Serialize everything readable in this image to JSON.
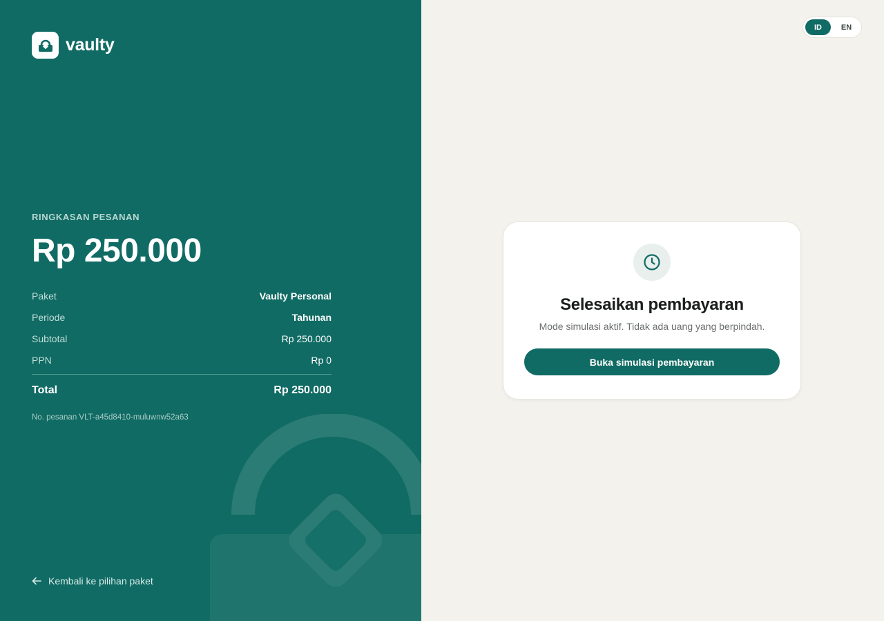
{
  "brand": {
    "name": "vaulty"
  },
  "summary": {
    "label": "RINGKASAN PESANAN",
    "amount": "Rp 250.000",
    "rows": [
      {
        "key": "Paket",
        "value": "Vaulty Personal"
      },
      {
        "key": "Periode",
        "value": "Tahunan"
      },
      {
        "key": "Subtotal",
        "value": "Rp 250.000"
      },
      {
        "key": "PPN",
        "value": "Rp 0"
      }
    ],
    "total": {
      "key": "Total",
      "value": "Rp 250.000"
    },
    "order_no": "No. pesanan VLT-a45d8410-muluwnw52a63"
  },
  "back_link": {
    "label": "Kembali ke pilihan paket",
    "icon": "arrow-left-icon"
  },
  "language": {
    "options": [
      "ID",
      "EN"
    ],
    "selected": "ID"
  },
  "payment_card": {
    "icon": "clock-icon",
    "title": "Selesaikan pembayaran",
    "subtitle": "Mode simulasi aktif. Tidak ada uang yang berpindah.",
    "button_label": "Buka simulasi pembayaran"
  },
  "colors": {
    "brand_green": "#106b64",
    "page_bg": "#f4f2ec",
    "card_bg": "#ffffff"
  }
}
